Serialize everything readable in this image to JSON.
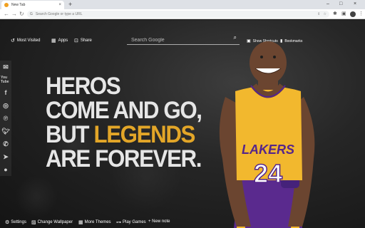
{
  "browser": {
    "tab_title": "New Tab",
    "tab_close": "×",
    "new_tab_symbol": "+",
    "omnibox_placeholder": "Search Google or type a URL",
    "window_controls": [
      "–",
      "□",
      "×"
    ]
  },
  "topbar": {
    "most_visited": "Most Visited",
    "apps": "Apps",
    "share": "Share",
    "show_shortcuts": "Show Shortcuts",
    "bookmarks": "Bookmarks"
  },
  "search": {
    "placeholder": "Search Google"
  },
  "quote": {
    "line1": "HEROS",
    "line2": "COME AND GO,",
    "line3_prefix": "BUT ",
    "line3_highlight": "LEGENDS",
    "line4": "ARE FOREVER."
  },
  "player": {
    "jersey_team": "LAKERS",
    "jersey_number": "24"
  },
  "social_icons": [
    "gmail-icon",
    "youtube-icon",
    "facebook-icon",
    "instagram-icon",
    "pinterest-icon",
    "twitter-icon",
    "whatsapp-icon",
    "telegram-icon",
    "reddit-icon"
  ],
  "social": {
    "youtube_text": "You Tube"
  },
  "bottombar": {
    "settings": "Settings",
    "change_wallpaper": "Change Wallpaper",
    "more_themes": "More Themes",
    "play_games": "Play Games",
    "new_note": "+ New note"
  },
  "colors": {
    "accent_gold": "#e3a628",
    "jersey_yellow": "#f2b82e",
    "jersey_purple": "#55258b"
  }
}
